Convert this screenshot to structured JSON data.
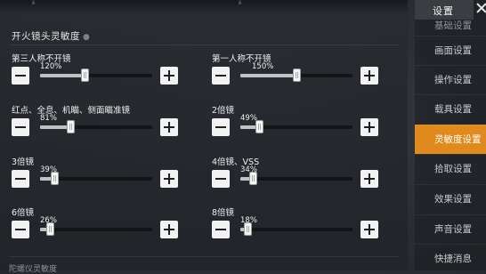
{
  "header": {
    "title": "设置",
    "close_icon": "close-icon"
  },
  "sidebar": {
    "items": [
      {
        "label": "基础设置",
        "active": false,
        "partial": true
      },
      {
        "label": "画面设置",
        "active": false
      },
      {
        "label": "操作设置",
        "active": false
      },
      {
        "label": "载具设置",
        "active": false
      },
      {
        "label": "灵敏度设置",
        "active": true
      },
      {
        "label": "拾取设置",
        "active": false
      },
      {
        "label": "效果设置",
        "active": false
      },
      {
        "label": "声音设置",
        "active": false
      },
      {
        "label": "快捷消息",
        "active": false
      }
    ]
  },
  "section": {
    "title": "开火镜头灵敏度",
    "next_section_partial": "陀螺仪灵敏度"
  },
  "settings": [
    {
      "label": "第三人称不开镜",
      "value": "120%",
      "level": 0.4
    },
    {
      "label": "第一人称不开镜",
      "value": "150%",
      "level": 0.5
    },
    {
      "label": "红点、全息、机瞄、侧面瞄准镜",
      "value": "81%",
      "level": 0.27
    },
    {
      "label": "2倍镜",
      "value": "49%",
      "level": 0.165
    },
    {
      "label": "3倍镜",
      "value": "39%",
      "level": 0.13
    },
    {
      "label": "4倍镜、VSS",
      "value": "34%",
      "level": 0.115
    },
    {
      "label": "6倍镜",
      "value": "26%",
      "level": 0.085
    },
    {
      "label": "8倍镜",
      "value": "18%",
      "level": 0.06
    }
  ],
  "colors": {
    "accent": "#e08a1e",
    "panel": "#2b2f34",
    "button": "#f2f2f2"
  }
}
